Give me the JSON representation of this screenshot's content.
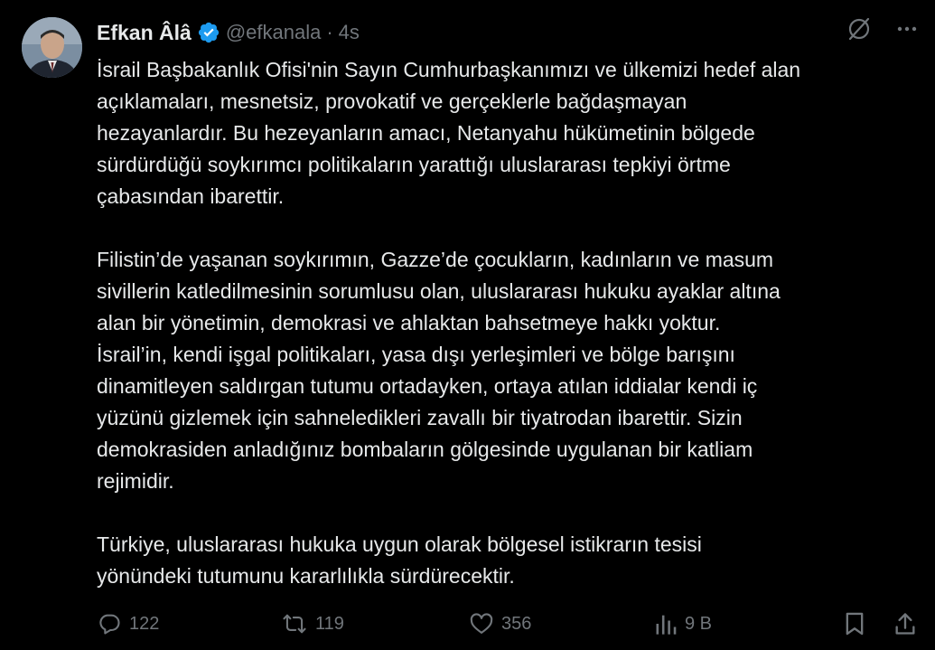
{
  "author": {
    "name": "Efkan Âlâ",
    "handle": "@efkanala",
    "separator": "·",
    "time": "4s"
  },
  "icons": {
    "verified": "verified-badge-icon",
    "grok": "grok-icon",
    "more": "more-options-icon",
    "reply": "reply-icon",
    "retweet": "retweet-icon",
    "like": "heart-icon",
    "views": "views-chart-icon",
    "bookmark": "bookmark-icon",
    "share": "share-icon"
  },
  "colors": {
    "background": "#000000",
    "text": "#e7e9ea",
    "muted": "#71767b",
    "verified": "#1d9bf0"
  },
  "tweet": {
    "paragraphs": [
      "İsrail Başbakanlık Ofisi'nin Sayın Cumhurbaşkanımızı ve ülkemizi hedef alan\naçıklamaları, mesnetsiz, provokatif ve gerçeklerle bağdaşmayan\nhezayanlardır. Bu hezeyanların amacı, Netanyahu hükümetinin bölgede\nsürdürdüğü soykırımcı politikaların yarattığı uluslararası tepkiyi örtme\nçabasından ibarettir.",
      "Filistin’de yaşanan soykırımın, Gazze’de çocukların, kadınların ve masum\nsivillerin katledilmesinin sorumlusu olan, uluslararası hukuku ayaklar altına\nalan bir yönetimin, demokrasi ve ahlaktan bahsetmeye hakkı yoktur.\nİsrail’in, kendi işgal politikaları, yasa dışı yerleşimleri ve bölge barışını\ndinamitleyen saldırgan tutumu ortadayken, ortaya atılan iddialar kendi iç\nyüzünü gizlemek için sahneledikleri zavallı bir tiyatrodan ibarettir. Sizin\ndemokrasiden anladığınız bombaların gölgesinde uygulanan bir katliam\nrejimidir.",
      "Türkiye, uluslararası hukuka uygun olarak bölgesel istikrarın tesisi\nyönündeki tutumunu kararlılıkla sürdürecektir."
    ]
  },
  "metrics": {
    "replies": "122",
    "retweets": "119",
    "likes": "356",
    "views": "9 B"
  }
}
